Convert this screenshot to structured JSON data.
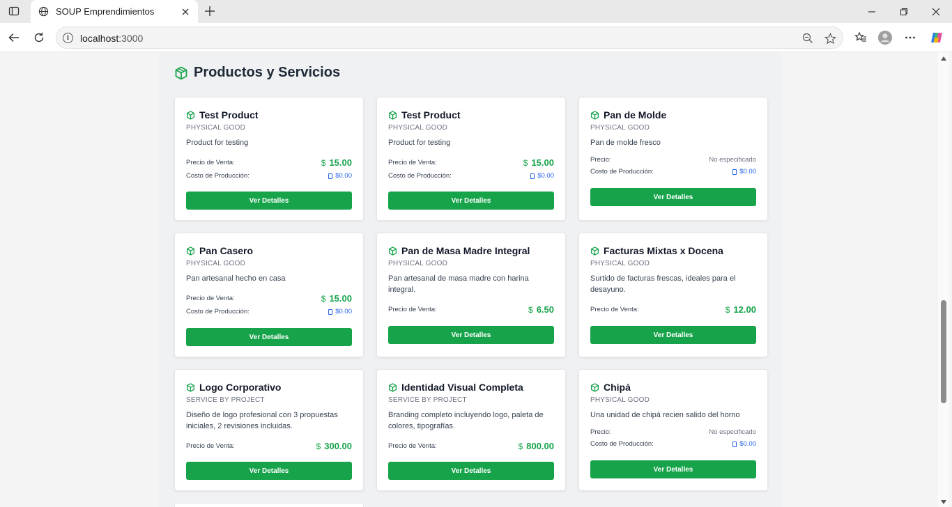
{
  "browser": {
    "tab_title": "SOUP Emprendimientos",
    "url_host": "localhost",
    "url_port": ":3000"
  },
  "section": {
    "title": "Productos y Servicios"
  },
  "labels": {
    "precio_venta": "Precio de Venta:",
    "costo_produccion": "Costo de Producción:",
    "precio": "Precio:",
    "no_especificado": "No especificado",
    "ver_detalles": "Ver Detalles",
    "currency": "$"
  },
  "products": [
    {
      "name": "Test Product",
      "type": "PHYSICAL GOOD",
      "description": "Product for testing",
      "price": "15.00",
      "cost": "$0.00"
    },
    {
      "name": "Test Product",
      "type": "PHYSICAL GOOD",
      "description": "Product for testing",
      "price": "15.00",
      "cost": "$0.00"
    },
    {
      "name": "Pan de Molde",
      "type": "PHYSICAL GOOD",
      "description": "Pan de molde fresco",
      "price": null,
      "cost": "$0.00"
    },
    {
      "name": "Pan Casero",
      "type": "PHYSICAL GOOD",
      "description": "Pan artesanal hecho en casa",
      "price": "15.00",
      "cost": "$0.00"
    },
    {
      "name": "Pan de Masa Madre Integral",
      "type": "PHYSICAL GOOD",
      "description": "Pan artesanal de masa madre con harina integral.",
      "price": "6.50",
      "cost": null
    },
    {
      "name": "Facturas Mixtas x Docena",
      "type": "PHYSICAL GOOD",
      "description": "Surtido de facturas frescas, ideales para el desayuno.",
      "price": "12.00",
      "cost": null
    },
    {
      "name": "Logo Corporativo",
      "type": "SERVICE BY PROJECT",
      "description": "Diseño de logo profesional con 3 propuestas iniciales, 2 revisiones incluidas.",
      "price": "300.00",
      "cost": null
    },
    {
      "name": "Identidad Visual Completa",
      "type": "SERVICE BY PROJECT",
      "description": "Branding completo incluyendo logo, paleta de colores, tipografías.",
      "price": "800.00",
      "cost": null
    },
    {
      "name": "Chipá",
      "type": "PHYSICAL GOOD",
      "description": "Una unidad de chipá recien salido del horno",
      "price": null,
      "cost": "$0.00"
    }
  ]
}
